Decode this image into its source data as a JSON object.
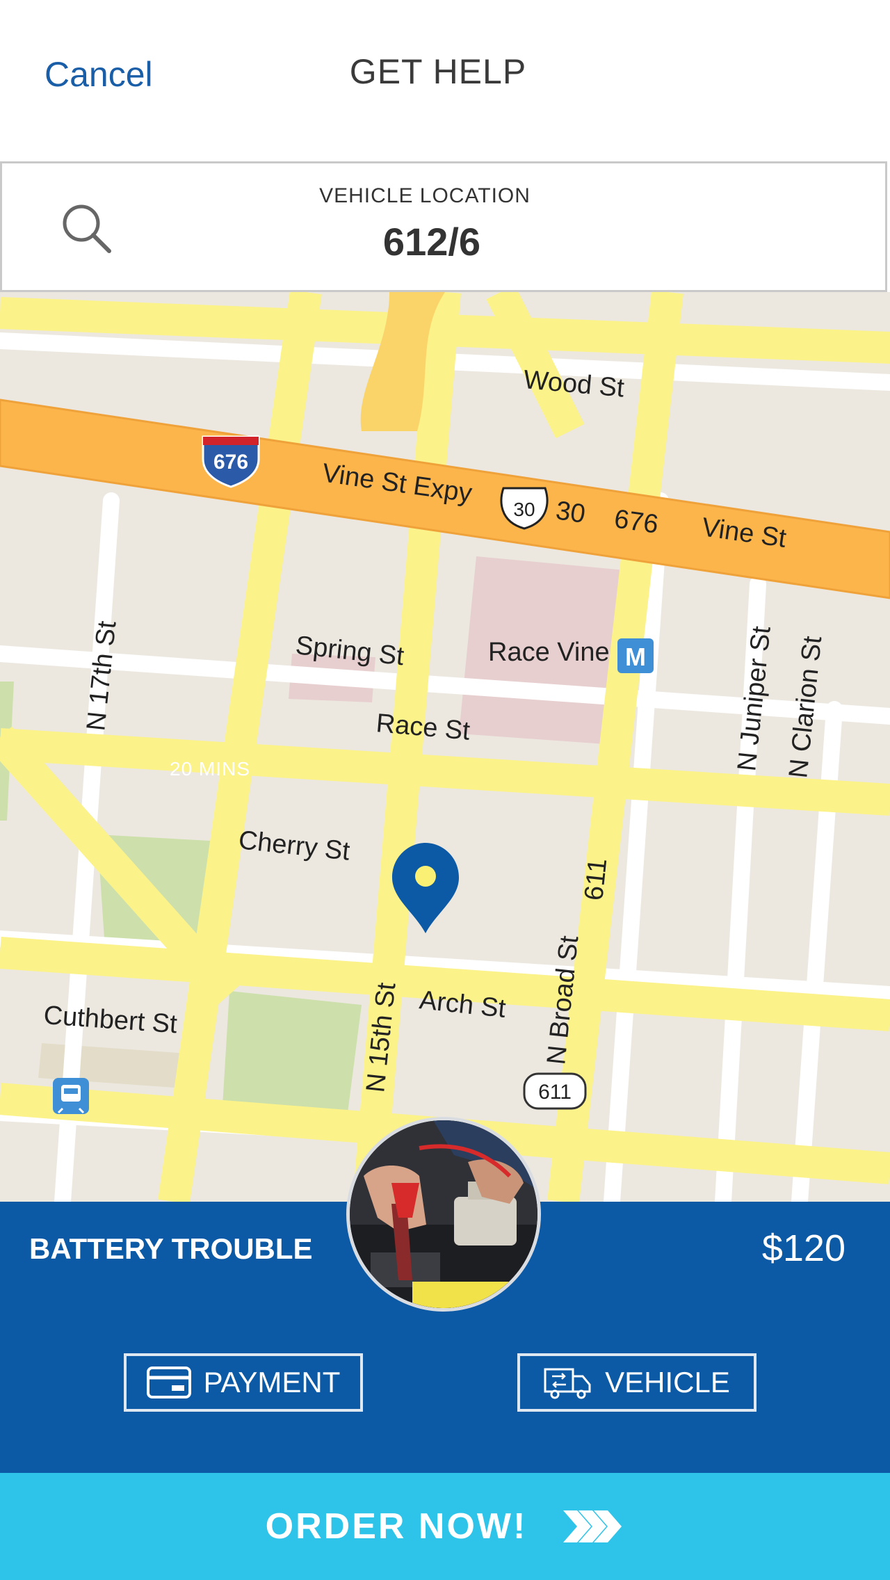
{
  "header": {
    "cancel_label": "Cancel",
    "title": "GET HELP"
  },
  "location": {
    "label": "VEHICLE LOCATION",
    "value": "612/6"
  },
  "map": {
    "eta": "20 MINS",
    "streets": {
      "wood": "Wood St",
      "vine_expy": "Vine St Expy",
      "num30": "30",
      "num676": "676",
      "vine": "Vine St",
      "n17th": "N 17th St",
      "spring": "Spring St",
      "race_vine": "Race Vine",
      "n_juniper": "N Juniper St",
      "n_clarion": "N Clarion St",
      "race": "Race St",
      "cherry": "Cherry St",
      "n611": "611",
      "n_15th": "N 15th St",
      "arch": "Arch St",
      "n_broad": "N Broad St",
      "cuthbert": "Cuthbert St"
    },
    "shields": {
      "i676": "676",
      "us30": "30",
      "r611": "611",
      "metro": "M"
    }
  },
  "service": {
    "name": "BATTERY TROUBLE",
    "price": "$120"
  },
  "buttons": {
    "payment": "PAYMENT",
    "vehicle": "VEHICLE"
  },
  "order": {
    "label": "ORDER  NOW!"
  },
  "icons": [
    "search-icon",
    "map-pin-icon",
    "card-icon",
    "truck-swap-icon",
    "chevrons-right-icon",
    "train-icon"
  ],
  "colors": {
    "brand_blue": "#0c5aa6",
    "cta_cyan": "#2ec4e9",
    "cancel_blue": "#1a5ea8"
  }
}
